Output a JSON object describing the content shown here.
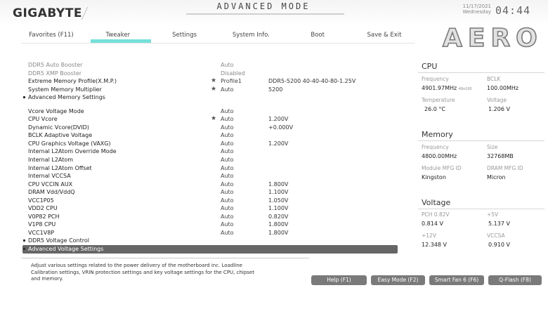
{
  "header": {
    "brand": "GIGABYTE",
    "mode_title": "ADVANCED MODE",
    "date": "11/17/2021",
    "weekday": "Wednesday",
    "time": "04:44",
    "product": "AERO"
  },
  "tabs": [
    {
      "label": "Favorites (F11)",
      "active": false
    },
    {
      "label": "Tweaker",
      "active": true
    },
    {
      "label": "Settings",
      "active": false
    },
    {
      "label": "System Info.",
      "active": false
    },
    {
      "label": "Boot",
      "active": false
    },
    {
      "label": "Save & Exit",
      "active": false
    }
  ],
  "settings": {
    "rows": [
      {
        "label": "DDR5 Auto Booster",
        "value": "Auto",
        "value2": "",
        "star": false,
        "dim": true
      },
      {
        "label": "DDR5 XMP Booster",
        "value": "Disabled",
        "value2": "",
        "star": false,
        "dim": true
      },
      {
        "label": "Extreme Memory Profile(X.M.P.)",
        "value": "Profile1",
        "value2": "DDR5-5200 40-40-40-80-1.25V",
        "star": true,
        "dim": false
      },
      {
        "label": "System Memory Multiplier",
        "value": "Auto",
        "value2": "5200",
        "star": true,
        "dim": false
      },
      {
        "label": "Advanced Memory Settings",
        "value": "",
        "value2": "",
        "star": false,
        "sub": true
      },
      {
        "label": "Vcore Voltage Mode",
        "value": "Auto",
        "value2": "",
        "star": false
      },
      {
        "label": "CPU Vcore",
        "value": "Auto",
        "value2": "1.200V",
        "star": true
      },
      {
        "label": "Dynamic Vcore(DVID)",
        "value": "Auto",
        "value2": "+0.000V",
        "star": false
      },
      {
        "label": "BCLK Adaptive Voltage",
        "value": "Auto",
        "value2": "",
        "star": false
      },
      {
        "label": "CPU Graphics Voltage (VAXG)",
        "value": "Auto",
        "value2": "1.200V",
        "star": false
      },
      {
        "label": "Internal L2Atom Override Mode",
        "value": "Auto",
        "value2": "",
        "star": false
      },
      {
        "label": "Internal L2Atom",
        "value": "Auto",
        "value2": "",
        "star": false
      },
      {
        "label": "Internal L2Atom Offset",
        "value": "Auto",
        "value2": "",
        "star": false
      },
      {
        "label": "Internal VCCSA",
        "value": "Auto",
        "value2": "",
        "star": false
      },
      {
        "label": "CPU VCCIN AUX",
        "value": "Auto",
        "value2": "1.800V",
        "star": false
      },
      {
        "label": "DRAM Vdd/VddQ",
        "value": "Auto",
        "value2": "1.100V",
        "star": false
      },
      {
        "label": "VCC1P05",
        "value": "Auto",
        "value2": "1.050V",
        "star": false
      },
      {
        "label": "VDD2 CPU",
        "value": "Auto",
        "value2": "1.100V",
        "star": false
      },
      {
        "label": "V0P82 PCH",
        "value": "Auto",
        "value2": "0.820V",
        "star": false
      },
      {
        "label": "V1P8 CPU",
        "value": "Auto",
        "value2": "1.800V",
        "star": false
      },
      {
        "label": "VCC1V8P",
        "value": "Auto",
        "value2": "1.800V",
        "star": false
      },
      {
        "label": "DDR5 Voltage Control",
        "value": "",
        "value2": "",
        "star": false,
        "sub": true
      },
      {
        "label": "Advanced Voltage Settings",
        "value": "",
        "value2": "",
        "star": false,
        "sub": true,
        "selected": true
      }
    ]
  },
  "help": {
    "text": "Adjust various settings related to the power delivery of the motherboard inc. Loadline Calibration settings, VRIN protection settings and key voltage settings for the CPU, chipset and memory."
  },
  "buttons": {
    "help": "Help (F1)",
    "easy_mode": "Easy Mode (F2)",
    "smart_fan": "Smart Fan 6 (F6)",
    "qflash": "Q-Flash (F8)"
  },
  "right_panel": {
    "cpu": {
      "title": "CPU",
      "frequency_label": "Frequency",
      "frequency_value": "4901.97MHz",
      "frequency_mult": "49x100",
      "bclk_label": "BCLK",
      "bclk_value": "100.00MHz",
      "temperature_label": "Temperature",
      "temperature_value": "26.0 °C",
      "voltage_label": "Voltage",
      "voltage_value": "1.206 V"
    },
    "memory": {
      "title": "Memory",
      "frequency_label": "Frequency",
      "frequency_value": "4800.00MHz",
      "size_label": "Size",
      "size_value": "32768MB",
      "module_mfg_label": "Module MFG ID",
      "module_mfg_value": "Kingston",
      "dram_mfg_label": "DRAM MFG ID",
      "dram_mfg_value": "Micron"
    },
    "voltage": {
      "title": "Voltage",
      "pch_label": "PCH 0.82V",
      "pch_value": "0.814 V",
      "p5v_label": "+5V",
      "p5v_value": "5.137 V",
      "p12v_label": "+12V",
      "p12v_value": "12.348 V",
      "vccsa_label": "VCCSA",
      "vccsa_value": "0.910 V"
    }
  }
}
